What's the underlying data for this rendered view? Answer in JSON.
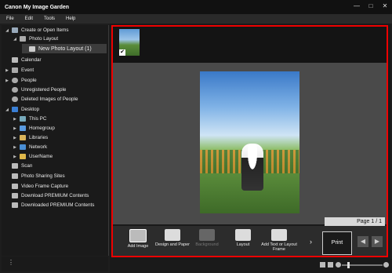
{
  "app": {
    "title": "Canon My Image Garden"
  },
  "window_controls": {
    "minimize": "—",
    "maximize": "□",
    "close": "✕"
  },
  "menu": [
    "File",
    "Edit",
    "Tools",
    "Help"
  ],
  "sidebar": {
    "items": [
      {
        "label": "Create or Open Items",
        "icon": "create-items-icon",
        "expanded": true
      },
      {
        "label": "Photo Layout",
        "icon": "photo-layout-icon",
        "expanded": true
      },
      {
        "label": "New Photo Layout (1)",
        "icon": "new-photo-layout-icon",
        "selected": true
      },
      {
        "label": "Calendar",
        "icon": "calendar-icon"
      },
      {
        "label": "Event",
        "icon": "event-icon"
      },
      {
        "label": "People",
        "icon": "people-icon"
      },
      {
        "label": "Unregistered People",
        "icon": "unregistered-people-icon"
      },
      {
        "label": "Deleted Images of People",
        "icon": "deleted-people-icon"
      },
      {
        "label": "Desktop",
        "icon": "desktop-icon",
        "expanded": true
      },
      {
        "label": "This PC",
        "icon": "this-pc-icon"
      },
      {
        "label": "Homegroup",
        "icon": "homegroup-icon"
      },
      {
        "label": "Libraries",
        "icon": "libraries-icon"
      },
      {
        "label": "Network",
        "icon": "network-icon"
      },
      {
        "label": "UserName",
        "icon": "user-folder-icon"
      },
      {
        "label": "Scan",
        "icon": "scan-icon"
      },
      {
        "label": "Photo Sharing Sites",
        "icon": "photo-sharing-icon"
      },
      {
        "label": "Video Frame Capture",
        "icon": "video-frame-icon"
      },
      {
        "label": "Download PREMIUM Contents",
        "icon": "download-premium-icon"
      },
      {
        "label": "Downloaded PREMIUM Contents",
        "icon": "downloaded-premium-icon"
      }
    ]
  },
  "page_indicator": "Page 1 / 1",
  "toolbar": {
    "add_image": "Add Image",
    "design_and_paper": "Design and Paper",
    "background": "Background",
    "layout": "Layout",
    "add_text": "Add Text or Layout Frame",
    "print": "Print"
  },
  "colors": {
    "highlight_border": "#e00000",
    "background": "#1a1a1a"
  }
}
